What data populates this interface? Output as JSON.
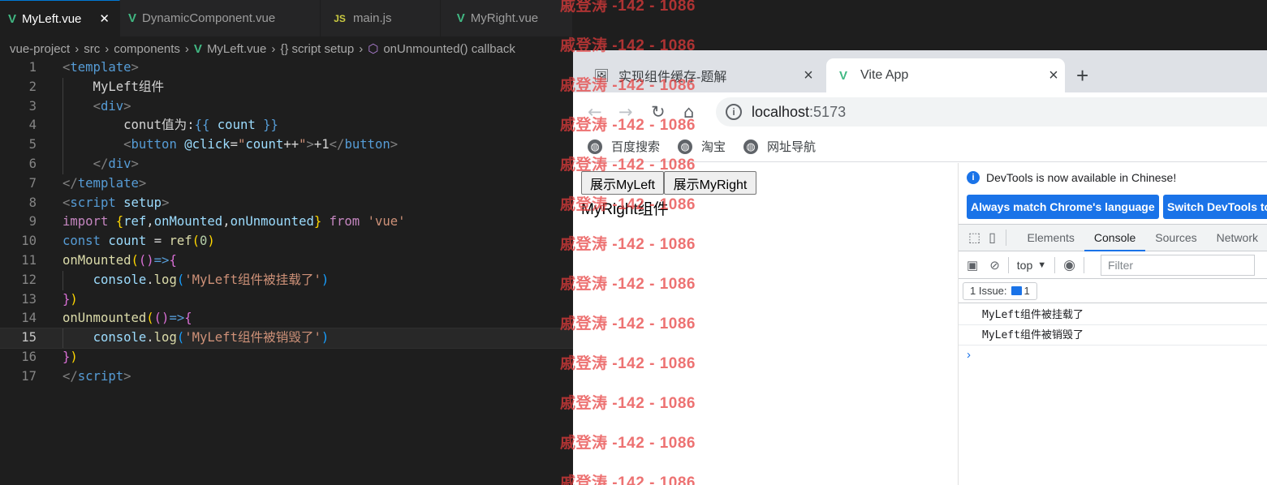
{
  "editor": {
    "tabs": [
      {
        "label": "MyLeft.vue",
        "type": "vue",
        "active": true
      },
      {
        "label": "DynamicComponent.vue",
        "type": "vue",
        "active": false
      },
      {
        "label": "main.js",
        "type": "js",
        "active": false
      },
      {
        "label": "MyRight.vue",
        "type": "vue",
        "active": false
      }
    ],
    "close_glyph": "✕",
    "breadcrumb": {
      "project": "vue-project",
      "src": "src",
      "components": "components",
      "file": "MyLeft.vue",
      "section": "{} script setup",
      "symbol": "onUnmounted() callback"
    },
    "lines": [
      "1",
      "2",
      "3",
      "4",
      "5",
      "6",
      "7",
      "8",
      "9",
      "10",
      "11",
      "12",
      "13",
      "14",
      "15",
      "16",
      "17"
    ],
    "current_line": "15"
  },
  "browser": {
    "tabs": [
      {
        "title": "实现组件缓存-题解",
        "favicon": "page-icon"
      },
      {
        "title": "Vite App",
        "favicon": "vue-logo-icon"
      }
    ],
    "new_tab": "+",
    "address": {
      "host": "localhost",
      "port": ":5173"
    },
    "bookmarks": [
      {
        "label": "百度搜索"
      },
      {
        "label": "淘宝"
      },
      {
        "label": "网址导航"
      }
    ],
    "page": {
      "btn_left": "展示MyLeft",
      "btn_right": "展示MyRight",
      "component_text": "MyRight组件"
    }
  },
  "devtools": {
    "notice": "DevTools is now available in Chinese!",
    "btn_match": "Always match Chrome's language",
    "btn_switch": "Switch DevTools to Chinese",
    "tabs": [
      "Elements",
      "Console",
      "Sources",
      "Network"
    ],
    "active_tab": "Console",
    "context": "top",
    "filter_placeholder": "Filter",
    "issues_label": "1 Issue:",
    "issues_count": "1",
    "logs": [
      "MyLeft组件被挂载了",
      "MyLeft组件被销毁了"
    ],
    "prompt": "›"
  },
  "watermark": "戚登涛 -142 - 1086",
  "colors": {
    "editor_bg": "#1e1e1e",
    "vue_green": "#41b883",
    "devtools_blue": "#1a73e8",
    "watermark_red": "#e63c3c"
  }
}
